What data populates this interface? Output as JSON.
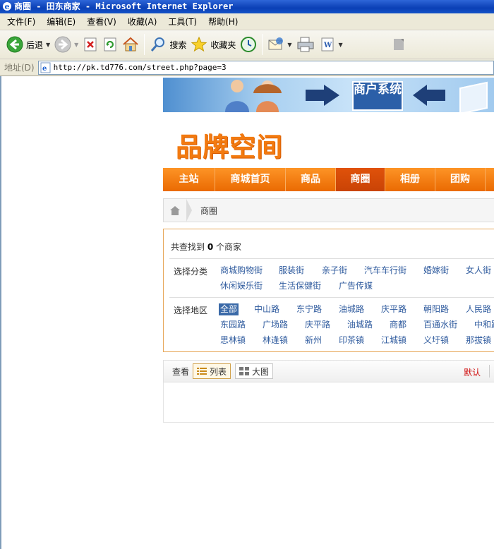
{
  "window": {
    "title": "商圈 - 田东商家 - Microsoft Internet Explorer"
  },
  "menu": [
    "文件(F)",
    "编辑(E)",
    "查看(V)",
    "收藏(A)",
    "工具(T)",
    "帮助(H)"
  ],
  "toolbar": {
    "back_label": "后退",
    "search_label": "搜索",
    "favorites_label": "收藏夹"
  },
  "address": {
    "label": "地址(D)",
    "url": "http://pk.td776.com/street.php?page=3"
  },
  "banner": {
    "text": "商户系统"
  },
  "logo": {
    "text": "品牌空间"
  },
  "nav": [
    {
      "label": "主站",
      "active": false
    },
    {
      "label": "商城首页",
      "active": false
    },
    {
      "label": "商品",
      "active": false
    },
    {
      "label": "商圈",
      "active": true
    },
    {
      "label": "相册",
      "active": false
    },
    {
      "label": "团购",
      "active": false
    }
  ],
  "breadcrumb": {
    "current": "商圈"
  },
  "results_count": {
    "prefix": "共查找到",
    "count": "0",
    "suffix": "个商家"
  },
  "category": {
    "label": "选择分类",
    "options": [
      "商城购物街",
      "服装街",
      "亲子街",
      "汽车车行街",
      "婚嫁街",
      "女人街",
      "休闲娱乐街",
      "生活保健街",
      "广告传媒"
    ]
  },
  "region": {
    "label": "选择地区",
    "options": [
      "全部",
      "中山路",
      "东宁路",
      "油城路",
      "庆平路",
      "朝阳路",
      "人民路",
      "东园路",
      "广场路",
      "庆平路",
      "油城路",
      "商都",
      "百通水街",
      "中和路",
      "思林镇",
      "林逢镇",
      "新州",
      "印茶镇",
      "江城镇",
      "义圩镇",
      "那拔镇"
    ],
    "selected": "全部"
  },
  "listbar": {
    "view_label": "查看",
    "list_label": "列表",
    "grid_label": "大图",
    "sort_default": "默认"
  },
  "colors": {
    "accent": "#f27a10",
    "nav": "#ea6a02",
    "link": "#2f5b9e",
    "selected": "#3b6aa8",
    "sort": "#d01010"
  }
}
